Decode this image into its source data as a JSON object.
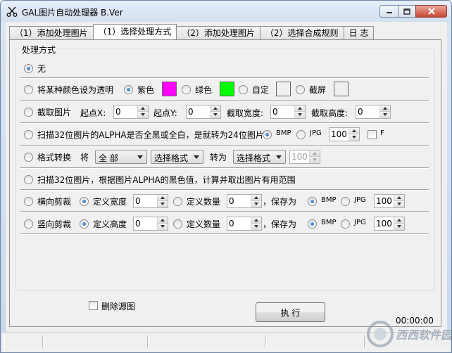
{
  "window": {
    "title": "GAL图片自动处理器 B.Ver"
  },
  "tabs": [
    {
      "label": "（1）添加处理图片",
      "active": false
    },
    {
      "label": "（1）选择处理方式",
      "active": true
    },
    {
      "label": "（2）添加处理图片",
      "active": false
    },
    {
      "label": "（2）选择合成规则",
      "active": false
    },
    {
      "label": "日 志",
      "active": false
    }
  ],
  "group": {
    "title": "处理方式"
  },
  "options": {
    "none": {
      "label": "无",
      "selected": true
    },
    "transparent": {
      "label": "将某种颜色设为透明",
      "selected": false,
      "magenta": {
        "label": "紫色",
        "selected": true,
        "color": "#ff00ff"
      },
      "green": {
        "label": "绿色",
        "selected": false,
        "color": "#00ff00"
      },
      "custom": {
        "label": "自定",
        "selected": false,
        "color": "#f0f0f0"
      },
      "screen": {
        "label": "截屏",
        "selected": false,
        "color": "#f0f0f0"
      }
    },
    "crop": {
      "label": "截取图片",
      "selected": false,
      "start_x_label": "起点X:",
      "start_x": "0",
      "start_y_label": "起点Y:",
      "start_y": "0",
      "width_label": "截取宽度:",
      "width": "0",
      "height_label": "截取高度:",
      "height": "0"
    },
    "alpha24": {
      "label": "扫描32位图片的ALPHA是否全黑或全白，是就转为24位图片",
      "selected": false,
      "bmp_label": "BMP",
      "bmp_selected": true,
      "jpg_label": "JPG",
      "jpg_selected": false,
      "quality": "100",
      "f_label": "F",
      "f_checked": false
    },
    "convert": {
      "label": "格式转换",
      "selected": false,
      "will_label": "将",
      "source": "全 部",
      "from_format": "选择格式",
      "to_label": "转为",
      "to_format": "选择格式",
      "quality": "100"
    },
    "alpha_scan": {
      "label": "扫描32位图片，根据图片ALPHA的黑色值，计算并取出图片有用范围",
      "selected": false
    },
    "hcut": {
      "label": "横向剪裁",
      "selected": false,
      "def_width_label": "定义宽度",
      "def_width_selected": true,
      "width_value": "0",
      "def_count_label": "定义数量",
      "def_count_selected": false,
      "count_value": "0",
      "save_as_label": "，保存为",
      "bmp_label": "BMP",
      "bmp_selected": true,
      "jpg_label": "JPG",
      "jpg_selected": false,
      "quality": "100"
    },
    "vcut": {
      "label": "竖向剪裁",
      "selected": false,
      "def_height_label": "定义高度",
      "def_height_selected": true,
      "height_value": "0",
      "def_count_label": "定义数量",
      "def_count_selected": false,
      "count_value": "0",
      "save_as_label": "，保存为",
      "bmp_label": "BMP",
      "bmp_selected": true,
      "jpg_label": "JPG",
      "jpg_selected": false,
      "quality": "100"
    }
  },
  "bottom": {
    "delete_source_label": "删除源图",
    "delete_source_checked": false,
    "execute_label": "执 行",
    "time": "00:00:00"
  },
  "watermark": "西西软件园"
}
